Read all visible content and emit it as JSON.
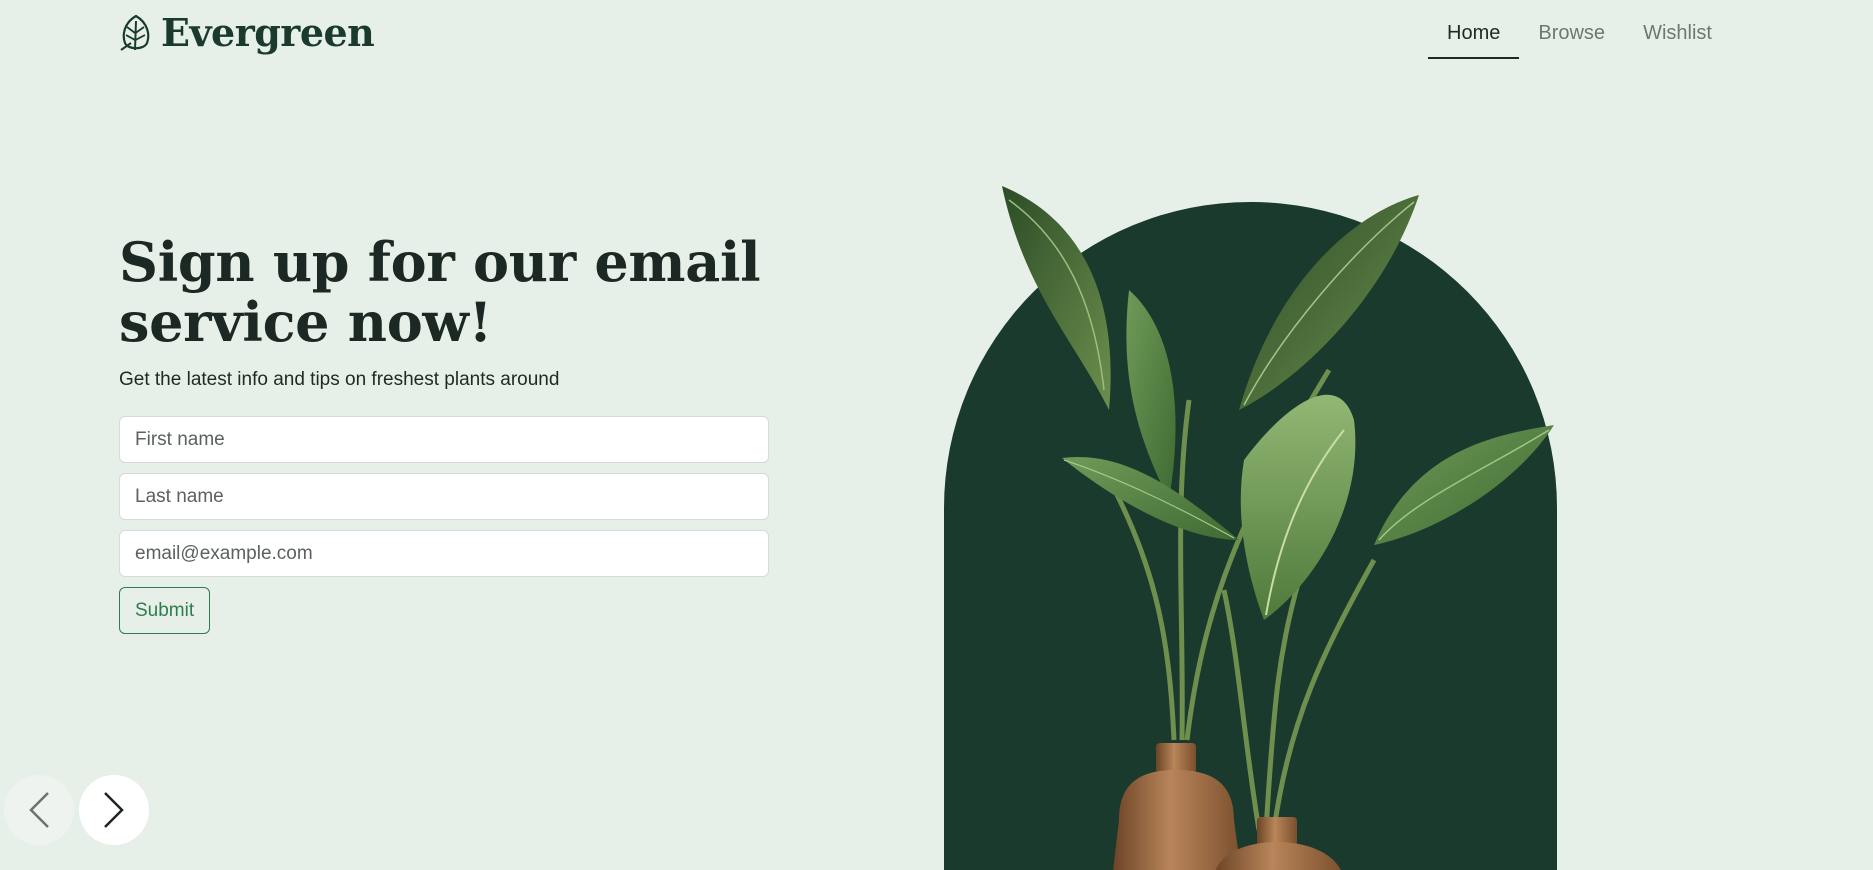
{
  "brand": {
    "name": "Evergreen",
    "icon": "leaf-icon"
  },
  "nav": {
    "items": [
      {
        "label": "Home",
        "active": true
      },
      {
        "label": "Browse",
        "active": false
      },
      {
        "label": "Wishlist",
        "active": false
      }
    ]
  },
  "hero": {
    "headline": "Sign up for our email service now!",
    "subtitle": "Get the latest info and tips on freshest plants around"
  },
  "form": {
    "first_name_placeholder": "First name",
    "last_name_placeholder": "Last name",
    "email_placeholder": "email@example.com",
    "submit_label": "Submit"
  },
  "carousel": {
    "prev_icon": "chevron-left-icon",
    "next_icon": "chevron-right-icon"
  },
  "colors": {
    "background": "#e6f0e8",
    "arch": "#1a3a2e",
    "accent": "#2f7d4f",
    "brand": "#1a3a2d"
  }
}
